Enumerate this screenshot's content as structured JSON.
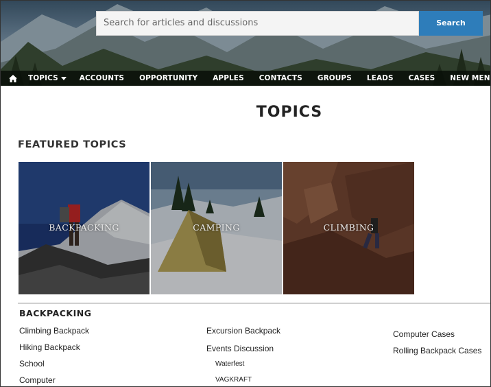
{
  "search": {
    "placeholder": "Search for articles and discussions",
    "button_label": "Search"
  },
  "nav": {
    "home_icon": "home-icon",
    "items": [
      "TOPICS",
      "ACCOUNTS",
      "OPPORTUNITY",
      "APPLES",
      "CONTACTS",
      "GROUPS",
      "LEADS",
      "CASES",
      "NEW MENU ITEM"
    ]
  },
  "page": {
    "title": "TOPICS",
    "featured_title": "FEATURED TOPICS"
  },
  "featured": [
    {
      "label": "BACKPACKING"
    },
    {
      "label": "CAMPING"
    },
    {
      "label": "CLIMBING"
    }
  ],
  "section": {
    "title": "BACKPACKING",
    "col1": [
      "Climbing Backpack",
      "Hiking Backpack",
      "School",
      "Computer"
    ],
    "col2": [
      "Excursion Backpack",
      "Events Discussion"
    ],
    "col2_sub": [
      "Waterfest",
      "VAGKRAFT"
    ],
    "col3": [
      "Computer Cases",
      "Rolling Backpack Cases"
    ]
  },
  "colors": {
    "search_button": "#2e7dba",
    "nav_bg": "#0e160e"
  }
}
